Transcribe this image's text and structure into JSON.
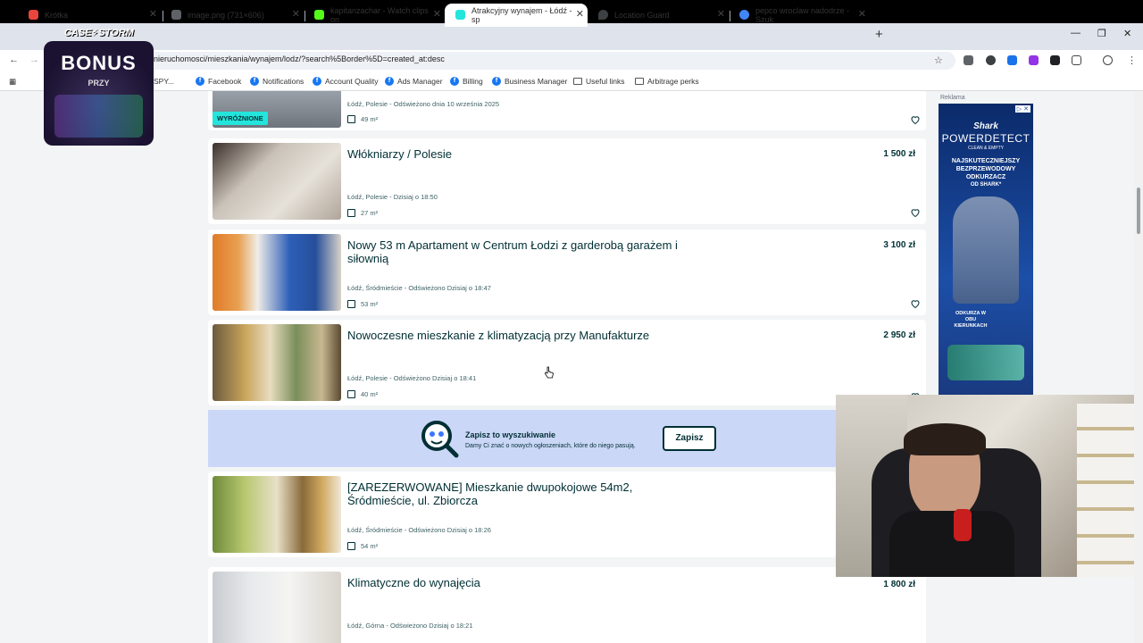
{
  "tabs": [
    {
      "title": "Krótka",
      "icon_color": "#e8453c",
      "active": false
    },
    {
      "title": "image.png (731×606)",
      "icon_color": "#5f6368",
      "active": false
    },
    {
      "title": "kapitanzachar - Watch clips on",
      "icon_color": "#53fc18",
      "active": false
    },
    {
      "title": "Atrakcyjny wynajem - Łódź - sp",
      "icon_color": "#23e5db",
      "active": true
    },
    {
      "title": "Location Guard",
      "icon_color": "#3c4043",
      "active": false
    },
    {
      "title": "pepco wroclaw nadodrze - Szuk",
      "icon_color": "#4285f4",
      "active": false
    }
  ],
  "address": {
    "url": "nieruchomosci/mieszkania/wynajem/lodz/?search%5Border%5D=created_at:desc"
  },
  "bookmarks": [
    {
      "label": "SPY...",
      "type": "text"
    },
    {
      "label": "Facebook",
      "type": "fb"
    },
    {
      "label": "Notifications",
      "type": "fb"
    },
    {
      "label": "Account Quality",
      "type": "fb"
    },
    {
      "label": "Ads Manager",
      "type": "fb"
    },
    {
      "label": "Billing",
      "type": "fb"
    },
    {
      "label": "Business Manager",
      "type": "fb"
    },
    {
      "label": "Useful links",
      "type": "folder"
    },
    {
      "label": "Arbitrage perks",
      "type": "folder"
    }
  ],
  "overlay": {
    "bonus": "BONUS",
    "przy": "PRZY",
    "brand": "CASE⚡STORM"
  },
  "listings": [
    {
      "title": "",
      "price": "",
      "location": "Łódź, Polesie - Odświeżono dnia 10 września 2025",
      "area": "49 m²",
      "badge": "WYRÓŻNIONE"
    },
    {
      "title": "Włókniarzy / Polesie",
      "price": "1 500 zł",
      "location": "Łódź, Polesie - Dzisiaj o 18:50",
      "area": "27 m²"
    },
    {
      "title": "Nowy 53 m Apartament w Centrum Łodzi z garderobą garażem i siłownią",
      "price": "3 100 zł",
      "location": "Łódź, Śródmieście - Odświeżono Dzisiaj o 18:47",
      "area": "53 m²"
    },
    {
      "title": "Nowoczesne mieszkanie z klimatyzacją przy Manufakturze",
      "price": "2 950 zł",
      "location": "Łódź, Polesie - Odświeżono Dzisiaj o 18:41",
      "area": "40 m²"
    },
    {
      "title": "[ZAREZERWOWANE] Mieszkanie dwupokojowe 54m2, Śródmieście, ul. Zbiorcza",
      "price": "",
      "location": "Łódź, Śródmieście - Odświeżono Dzisiaj o 18:26",
      "area": "54 m²"
    },
    {
      "title": "Klimatyczne do wynajęcia",
      "price": "1 800 zł",
      "location": "Łódź, Górna - Odświeżono Dzisiaj o 18:21",
      "area": ""
    }
  ],
  "save_search": {
    "title": "Zapisz to wyszukiwanie",
    "subtitle": "Damy Ci znać o nowych ogłoszeniach, które do niego pasują.",
    "button": "Zapisz"
  },
  "ad": {
    "label": "Reklama",
    "brand": "Shark",
    "product": "POWERDETECT",
    "tagline": "CLEAN & EMPTY",
    "headline": "NAJSKUTECZNIEJSZY BEZPRZEWODOWY ODKURZACZ",
    "sub": "OD SHARK*",
    "bottom": "ODKURZA W OBU KIERUNKACH"
  }
}
